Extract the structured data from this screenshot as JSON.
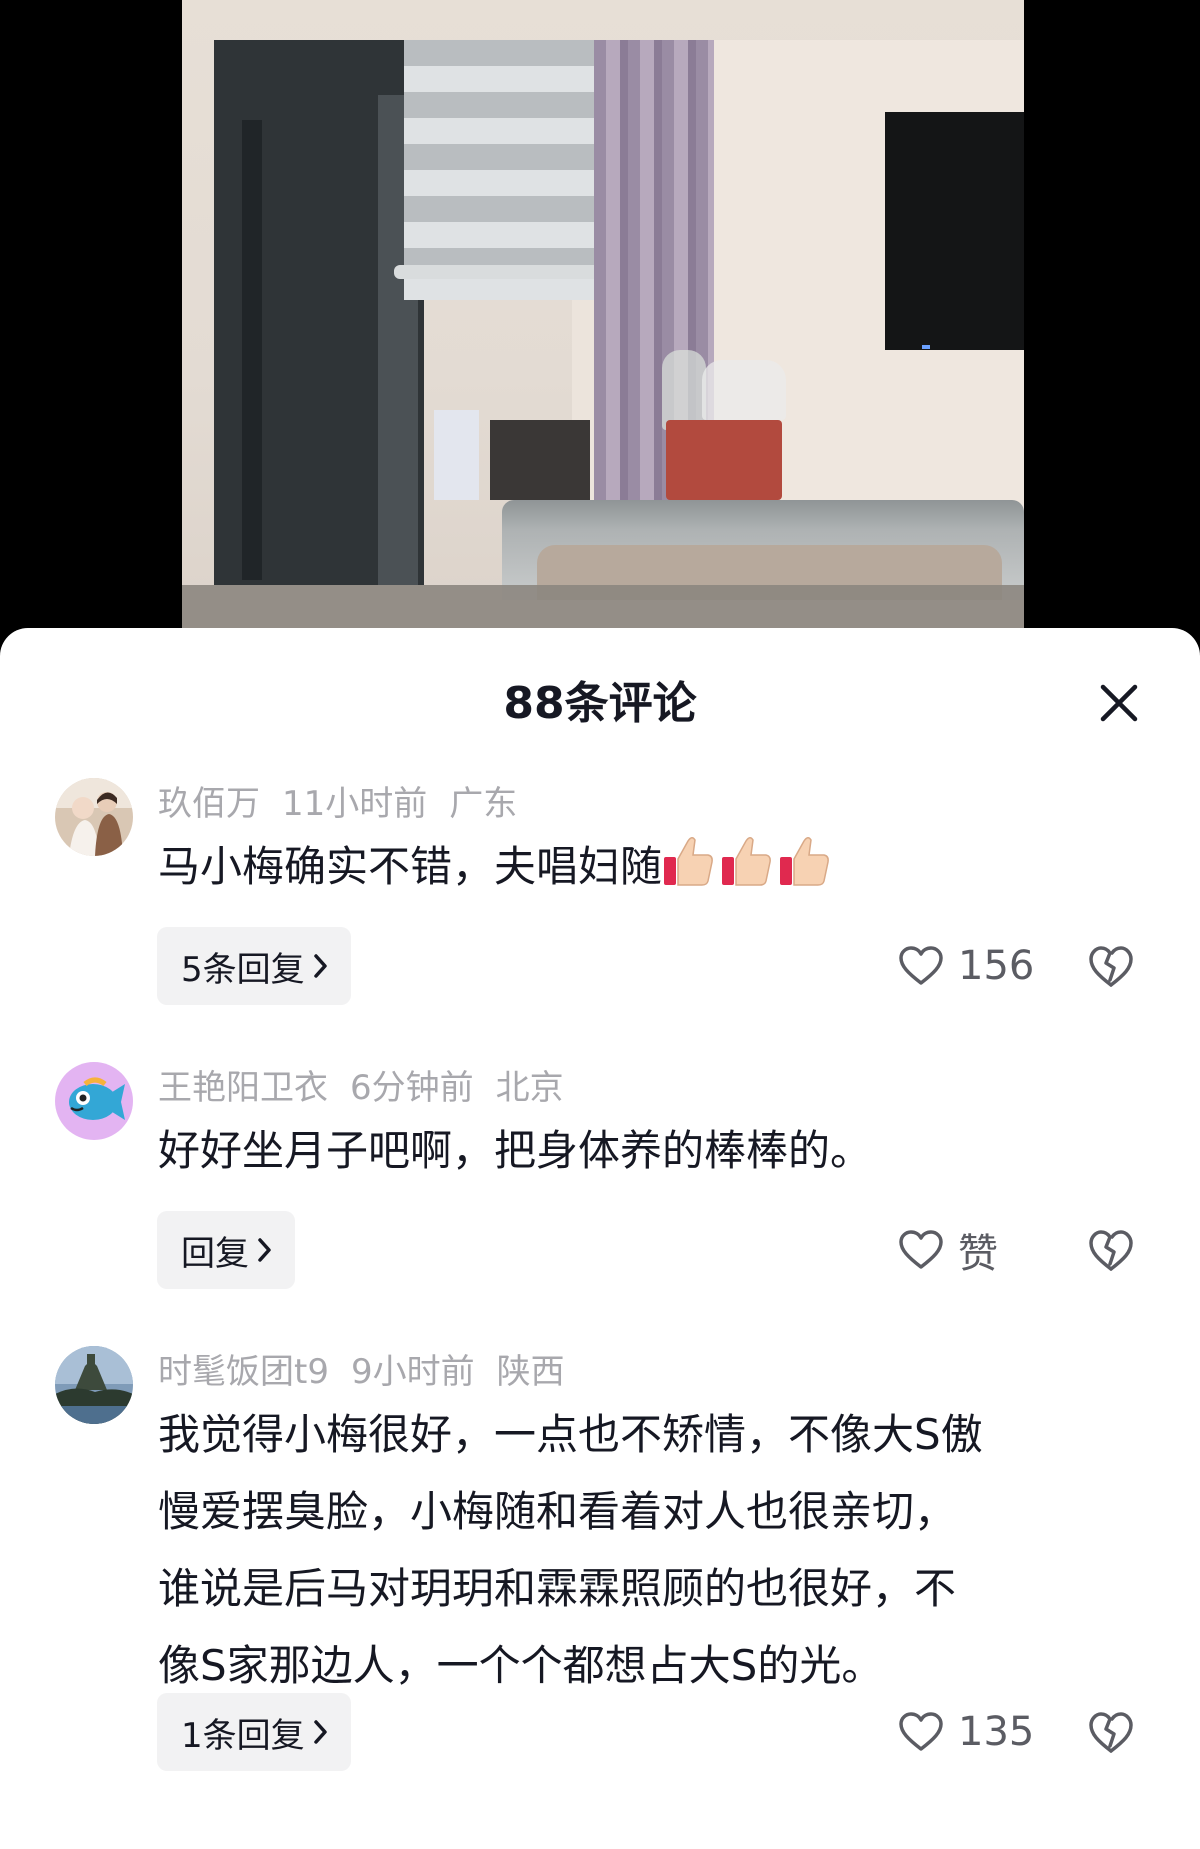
{
  "video": {},
  "sheet": {
    "title": "88条评论"
  },
  "comments": [
    {
      "user": "玖佰万",
      "time": "11小时前",
      "location": "广东",
      "text": "马小梅确实不错，夫唱妇随",
      "emoji": [
        "thumbs-up",
        "thumbs-up",
        "thumbs-up"
      ],
      "reply_label": "5条回复",
      "likes": "156"
    },
    {
      "user": "王艳阳卫衣",
      "time": "6分钟前",
      "location": "北京",
      "text": "好好坐月子吧啊，把身体养的棒棒的。",
      "reply_label": "回复",
      "likes": "赞"
    },
    {
      "user": "时髦饭团t9",
      "time": "9小时前",
      "location": "陕西",
      "text_lines": [
        "我觉得小梅很好，一点也不矫情，不像大S傲",
        "慢爱摆臭脸，小梅随和看着对人也很亲切，",
        "谁说是后马对玥玥和霖霖照顾的也很好，不",
        "像S家那边人，一个个都想占大S的光。"
      ],
      "reply_label": "1条回复",
      "likes": "135"
    }
  ],
  "colors": {
    "text": "#161823",
    "meta": "#a8a8ad",
    "reply_bg": "#f2f2f3"
  }
}
